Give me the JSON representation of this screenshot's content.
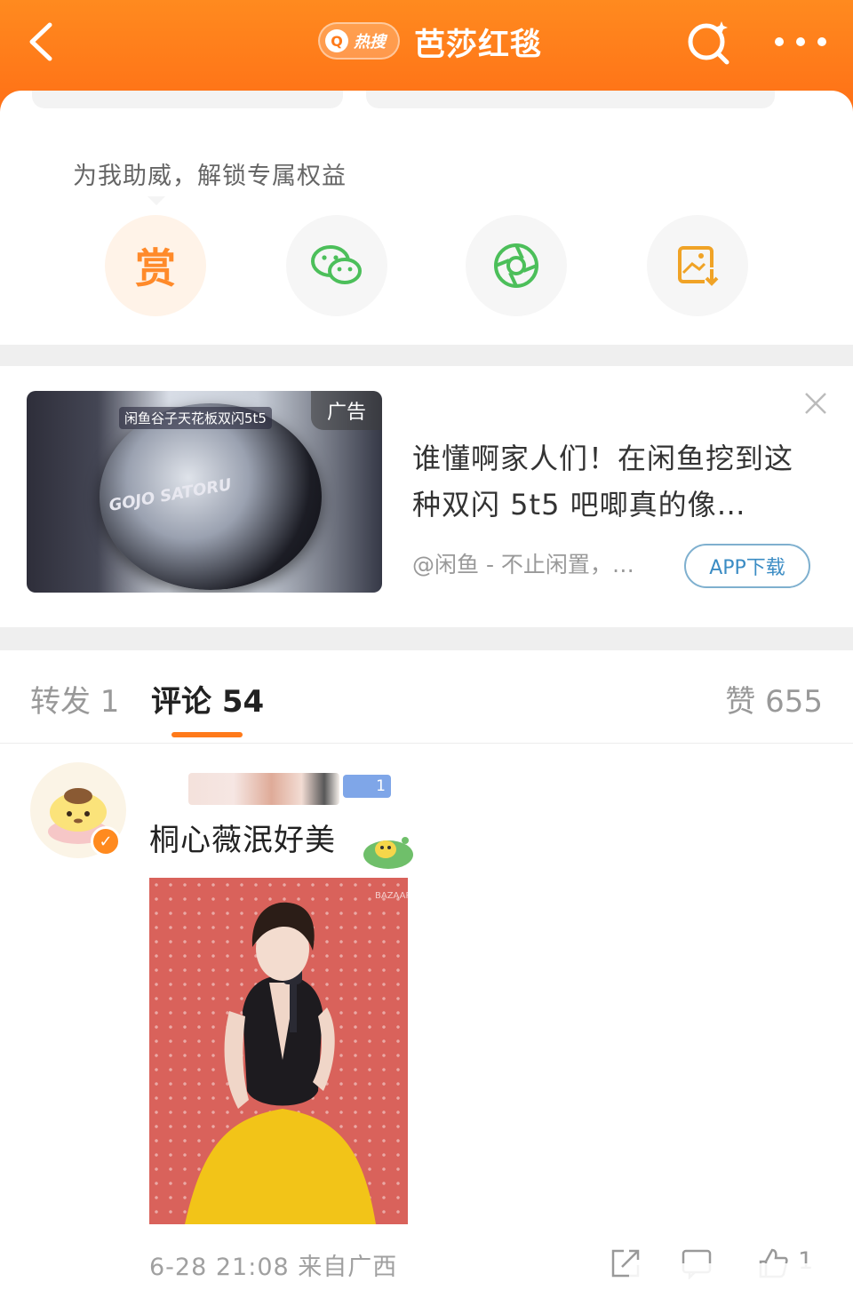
{
  "header": {
    "hot_badge_q": "Q",
    "hot_badge_text": "热搜",
    "title": "芭莎红毯"
  },
  "card": {
    "support_text": "为我助威，解锁专属权益",
    "reward_label": "赏"
  },
  "ad": {
    "tag": "广告",
    "image_caption": "闲鱼谷子天花板双闪5t5",
    "image_text": "GOJO SATORU",
    "title": "谁懂啊家人们！在闲鱼挖到这种双闪 5t5 吧唧真的像…",
    "source": "@闲鱼 - 不止闲置，…",
    "download_label": "APP下载"
  },
  "tabs": {
    "repost": "转发 1",
    "comment": "评论 54",
    "like": "赞 655"
  },
  "comment": {
    "level_badge": "1",
    "text": "桐心薇泯好美",
    "photo_watermark": "BAZAAR",
    "meta": "6-28 21:08 来自广西",
    "like_count": "1"
  },
  "colors": {
    "header_orange": "#ff7a1a",
    "accent_orange": "#ff8a2a",
    "link_blue": "#3b8cc4",
    "wechat_green": "#4cbf5a",
    "level_blue": "#7fa6e8"
  },
  "icons": [
    "back-arrow-icon",
    "refresh-search-icon",
    "more-dots-icon",
    "reward-icon",
    "wechat-icon",
    "moments-icon",
    "save-image-icon",
    "close-icon",
    "share-icon",
    "reply-icon",
    "like-icon"
  ]
}
